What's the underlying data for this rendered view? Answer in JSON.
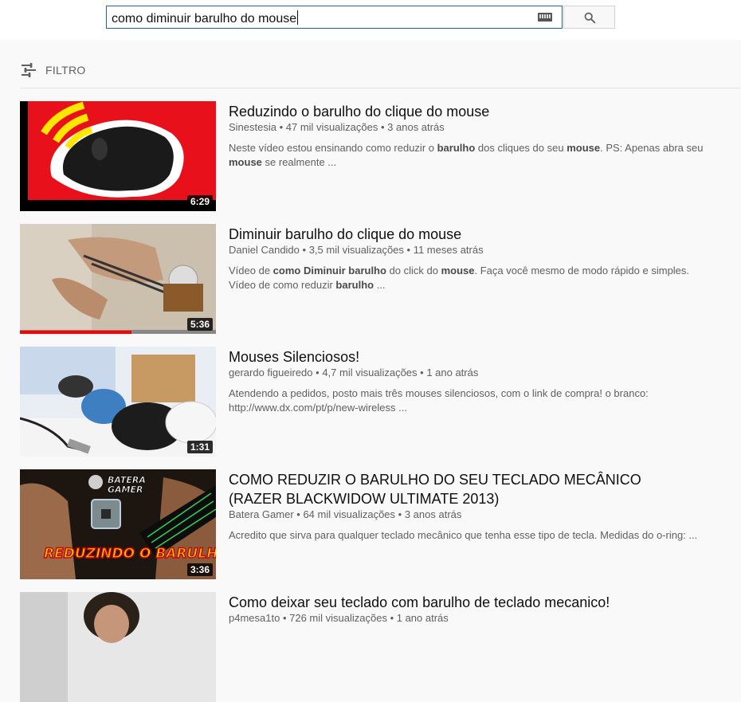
{
  "search": {
    "query": "como diminuir barulho do mouse",
    "keyboard_icon": "keyboard-icon",
    "search_icon": "search-icon"
  },
  "filter": {
    "label": "FILTRO",
    "icon": "filter-icon"
  },
  "results": [
    {
      "title": "Reduzindo o barulho do clique do mouse",
      "channel": "Sinestesia",
      "views": "47 mil visualizações",
      "age": "3 anos atrás",
      "duration": "6:29",
      "description": [
        {
          "t": "Neste vídeo estou ensinando como reduzir o ",
          "b": false
        },
        {
          "t": "barulho",
          "b": true
        },
        {
          "t": " dos cliques do seu ",
          "b": false
        },
        {
          "t": "mouse",
          "b": true
        },
        {
          "t": ". PS: Apenas abra seu ",
          "b": false
        },
        {
          "t": "mouse",
          "b": true
        },
        {
          "t": " se realmente ...",
          "b": false
        }
      ]
    },
    {
      "title": "Diminuir barulho do clique do mouse",
      "channel": "Daniel Candido",
      "views": "3,5 mil visualizações",
      "age": "11 meses atrás",
      "duration": "5:36",
      "watched_fraction": 0.57,
      "description": [
        {
          "t": "Vídeo de ",
          "b": false
        },
        {
          "t": "como Diminuir barulho",
          "b": true
        },
        {
          "t": " do click do ",
          "b": false
        },
        {
          "t": "mouse",
          "b": true
        },
        {
          "t": ". Faça você mesmo de modo rápido e simples. Vídeo de como reduzir ",
          "b": false
        },
        {
          "t": "barulho",
          "b": true
        },
        {
          "t": " ...",
          "b": false
        }
      ]
    },
    {
      "title": "Mouses Silenciosos!",
      "channel": "gerardo figueiredo",
      "views": "4,7 mil visualizações",
      "age": "1 ano atrás",
      "duration": "1:31",
      "description": [
        {
          "t": "Atendendo a pedidos, posto mais três mouses silenciosos, com o link de compra! o branco: http://www.dx.com/pt/p/new-wireless ...",
          "b": false
        }
      ]
    },
    {
      "title": "COMO REDUZIR O BARULHO DO SEU TECLADO MECÂNICO (RAZER BLACKWIDOW ULTIMATE 2013)",
      "channel": "Batera Gamer",
      "views": "64 mil visualizações",
      "age": "3 anos atrás",
      "duration": "3:36",
      "thumb_text_top": "BATERA GAMER",
      "thumb_text_bottom": "REDUZINDO O BARULHO",
      "description": [
        {
          "t": "Acredito que sirva para qualquer teclado mecânico que tenha esse tipo de tecla. Medidas do o-ring: ...",
          "b": false
        }
      ]
    },
    {
      "title": "Como deixar seu teclado com barulho de teclado mecanico!",
      "channel": "p4mesa1to",
      "views": "726 mil visualizações",
      "age": "1 ano atrás",
      "duration": "",
      "description": []
    }
  ],
  "colors": {
    "accent_border": "#1c62b9",
    "progress": "#ff0000"
  }
}
